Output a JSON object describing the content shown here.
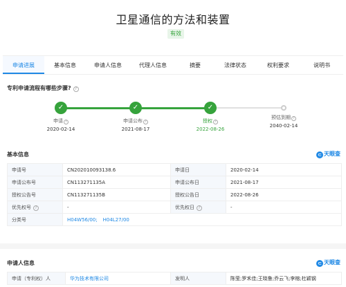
{
  "header": {
    "title": "卫星通信的方法和装置",
    "status": "有效"
  },
  "tabs": [
    {
      "label": "申请进展",
      "active": true
    },
    {
      "label": "基本信息"
    },
    {
      "label": "申请人信息"
    },
    {
      "label": "代理人信息"
    },
    {
      "label": "摘要"
    },
    {
      "label": "法律状态"
    },
    {
      "label": "权利要求"
    },
    {
      "label": "说明书"
    }
  ],
  "progress": {
    "question": "专利申请流程有哪些步骤?",
    "steps": [
      {
        "label": "申请",
        "date": "2020-02-14",
        "done": true
      },
      {
        "label": "申请公布",
        "date": "2021-08-17",
        "done": true
      },
      {
        "label": "授权",
        "date": "2022-08-26",
        "done": true
      },
      {
        "label": "预估到期",
        "date": "2040-02-14",
        "done": false
      }
    ]
  },
  "basic_info": {
    "title": "基本信息",
    "brand": "天眼查",
    "rows": [
      {
        "k1": "申请号",
        "v1": "CN202010093138.6",
        "k2": "申请日",
        "v2": "2020-02-14"
      },
      {
        "k1": "申请公布号",
        "v1": "CN113271135A",
        "k2": "申请公布日",
        "v2": "2021-08-17"
      },
      {
        "k1": "授权公告号",
        "v1": "CN113271135B",
        "k2": "授权公告日",
        "v2": "2022-08-26"
      },
      {
        "k1": "优先权号",
        "v1": "-",
        "k2": "优先权日",
        "v2": "-"
      }
    ],
    "class_label": "分类号",
    "class_codes": [
      "H04W56/00;",
      "H04L27/00"
    ]
  },
  "applicant_info": {
    "title": "申请人信息",
    "brand": "天眼查",
    "k1": "申请（专利权）人",
    "v1": "华为技术有限公司",
    "k2": "发明人",
    "v2": "陈莹;罗禾佳;王晓鲁;乔云飞;李榕;杜颖钢"
  }
}
